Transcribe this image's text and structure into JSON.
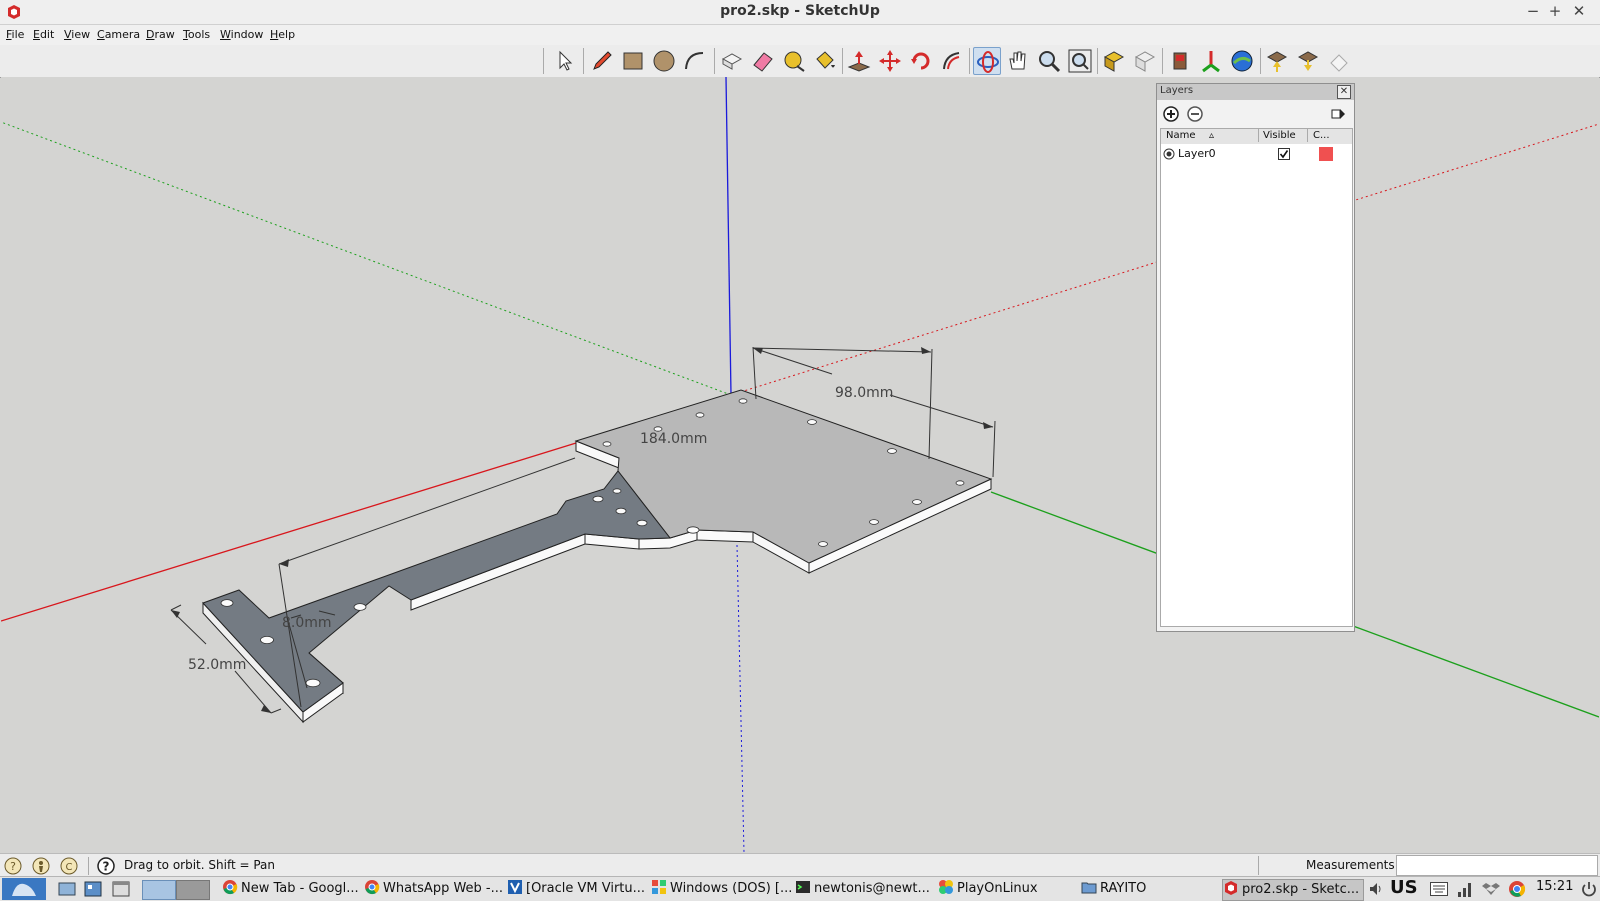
{
  "window": {
    "title": "pro2.skp - SketchUp",
    "controls": [
      "minimize-icon",
      "maximize-icon",
      "close-icon"
    ],
    "minimize": "−",
    "maximize": "+",
    "close": "✕"
  },
  "menu": {
    "items": [
      {
        "key": "F",
        "rest": "ile"
      },
      {
        "key": "E",
        "rest": "dit"
      },
      {
        "key": "V",
        "rest": "iew"
      },
      {
        "key": "C",
        "rest": "amera"
      },
      {
        "key": "D",
        "rest": "raw"
      },
      {
        "key": "T",
        "rest": "ools"
      },
      {
        "key": "W",
        "rest": "indow"
      },
      {
        "key": "H",
        "rest": "elp"
      }
    ]
  },
  "toolbar": {
    "tools": [
      "select-icon",
      "pencil-icon",
      "rectangle-icon",
      "circle-icon",
      "arc-icon",
      "make-component-icon",
      "eraser-icon",
      "tape-measure-icon",
      "paint-bucket-icon",
      "push-pull-icon",
      "move-icon",
      "rotate-icon",
      "offset-icon",
      "orbit-icon",
      "pan-icon",
      "zoom-icon",
      "zoom-extents-icon",
      "get-models-icon",
      "share-model-icon",
      "components-icon",
      "photo-textures-icon",
      "google-earth-icon",
      "extension-warehouse-icon",
      "share-component-icon",
      "send-to-layout-icon"
    ],
    "active_tool": "orbit-icon"
  },
  "model": {
    "dimensions": {
      "width": "98.0mm",
      "length": "184.0mm",
      "neck": "8.0mm",
      "foot": "52.0mm"
    },
    "axis_colors": {
      "red": "#d8161c",
      "green": "#1ca01c",
      "blue": "#1a1adb"
    }
  },
  "layers_panel": {
    "title": "Layers",
    "close": "✕",
    "columns": {
      "name": "Name",
      "visible": "Visible",
      "color": "C..."
    },
    "rows": [
      {
        "name": "Layer0",
        "visible": true,
        "color": "#f05050",
        "active": true
      }
    ]
  },
  "statusbar": {
    "hint": "Drag to orbit.  Shift = Pan",
    "measurements_label": "Measurements",
    "measurements_value": ""
  },
  "taskbar": {
    "tasks": [
      {
        "label": "New Tab - Googl...",
        "icon": "chrome-icon"
      },
      {
        "label": "WhatsApp Web -...",
        "icon": "chrome-icon"
      },
      {
        "label": "[Oracle VM Virtu...",
        "icon": "virtualbox-icon"
      },
      {
        "label": "Windows (DOS) [...",
        "icon": "windows-icon"
      },
      {
        "label": "newtonis@newt...",
        "icon": "terminal-icon"
      },
      {
        "label": "PlayOnLinux",
        "icon": "playonlinux-icon"
      },
      {
        "label": "RAYITO",
        "icon": "folder-icon"
      },
      {
        "label": "pro2.skp - Sketc...",
        "icon": "sketchup-icon",
        "active": true
      }
    ],
    "keyboard_layout": "US",
    "clock": "15:21"
  }
}
